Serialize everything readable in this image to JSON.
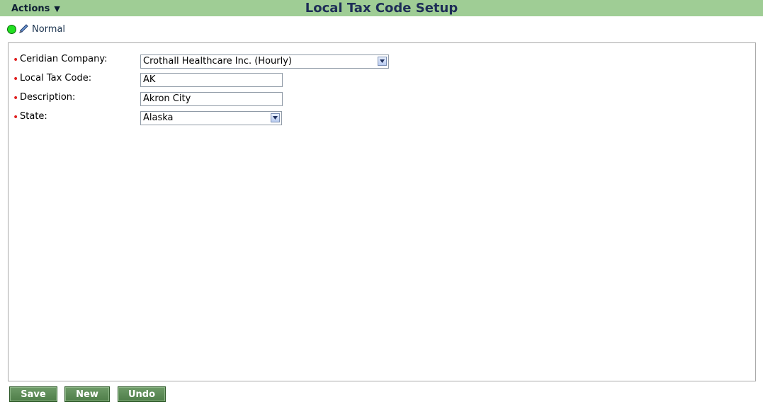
{
  "header": {
    "actions_label": "Actions",
    "actions_arrow": "▼",
    "title": "Local Tax Code Setup",
    "bar_color": "#9fcd95"
  },
  "status": {
    "label": "Normal",
    "dot_color": "#22e022",
    "icon": "pencil-icon"
  },
  "form": {
    "required_marker": "•",
    "fields": {
      "company": {
        "label": "Ceridian Company:",
        "value": "Crothall Healthcare Inc. (Hourly)"
      },
      "tax_code": {
        "label": "Local Tax Code:",
        "value": "AK"
      },
      "description": {
        "label": "Description:",
        "value": "Akron City"
      },
      "state": {
        "label": "State:",
        "value": "Alaska"
      }
    }
  },
  "buttons": {
    "save": "Save",
    "new": "New",
    "undo": "Undo",
    "color": "#5a8a54"
  }
}
